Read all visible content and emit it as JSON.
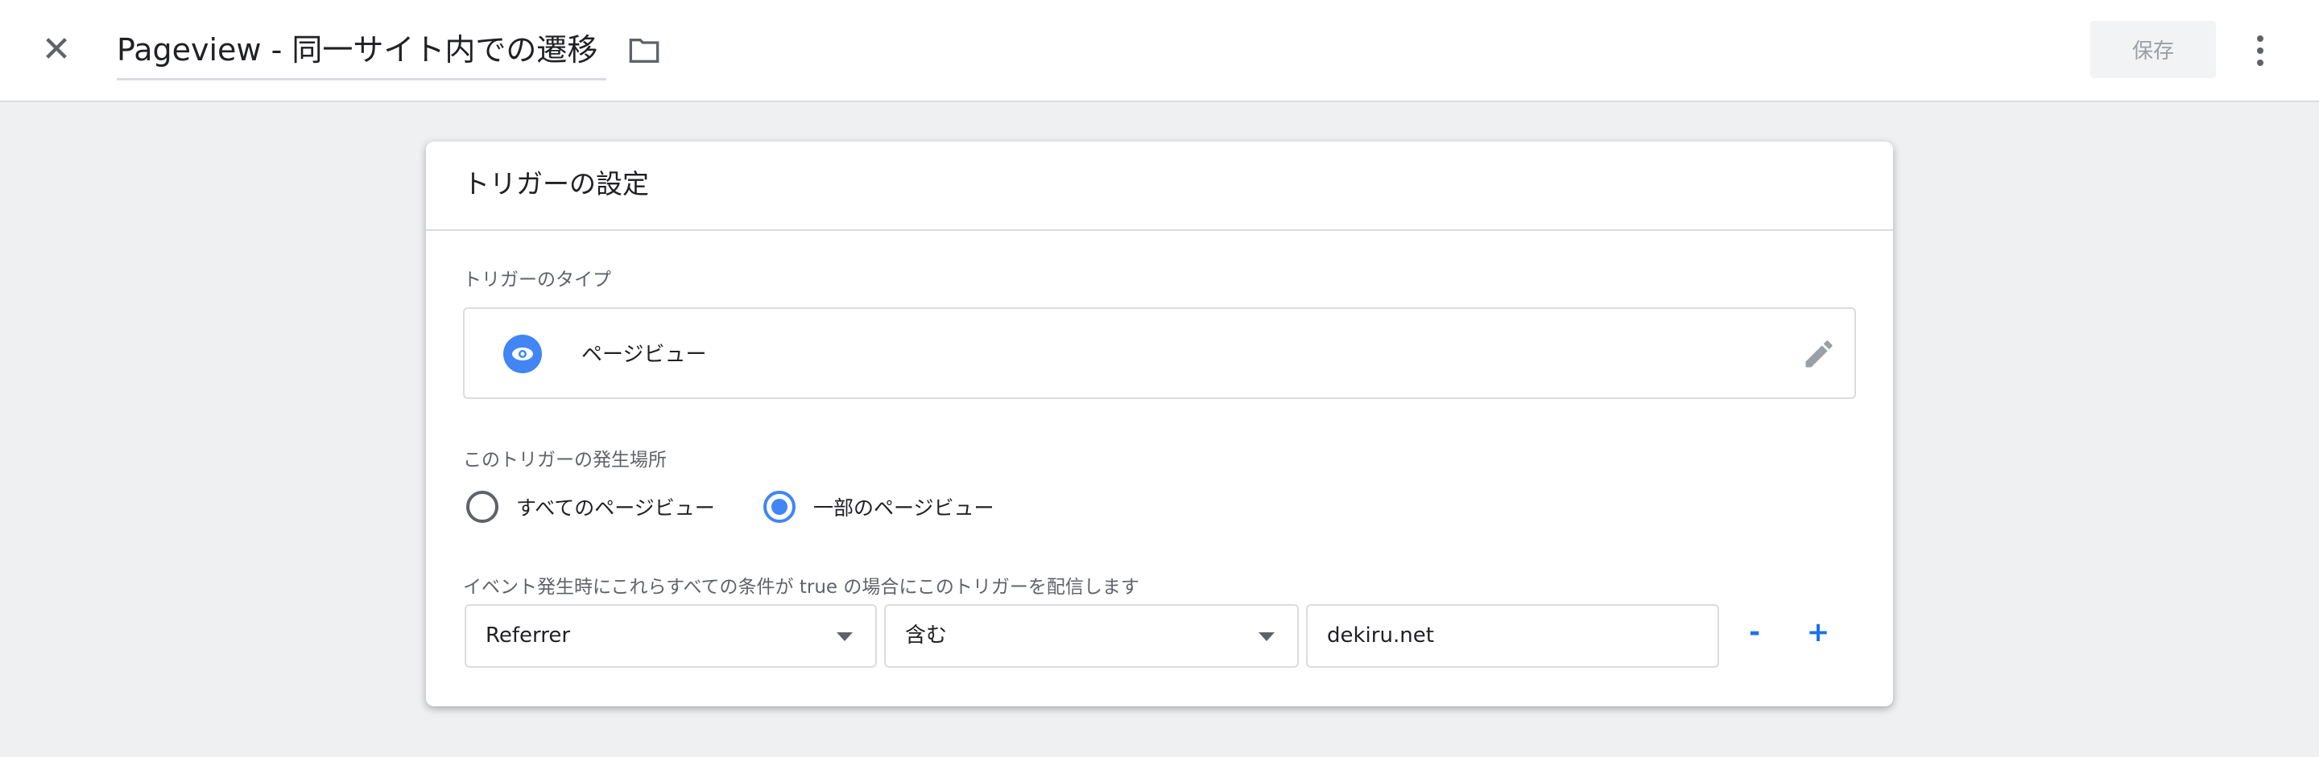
{
  "header": {
    "title": "Pageview - 同一サイト内での遷移",
    "save_label": "保存"
  },
  "card": {
    "title": "トリガーの設定",
    "type_label": "トリガーのタイプ",
    "type_value": "ページビュー",
    "fires_on_label": "このトリガーの発生場所",
    "radio_options": [
      {
        "label": "すべてのページビュー",
        "selected": false
      },
      {
        "label": "一部のページビュー",
        "selected": true
      }
    ],
    "condition_label": "イベント発生時にこれらすべての条件が true の場合にこのトリガーを配信します",
    "condition": {
      "variable": "Referrer",
      "operator": "含む",
      "value": "dekiru.net"
    },
    "remove_label": "-",
    "add_label": "+"
  },
  "colors": {
    "accent": "#4285f4",
    "link": "#1a73e8"
  }
}
